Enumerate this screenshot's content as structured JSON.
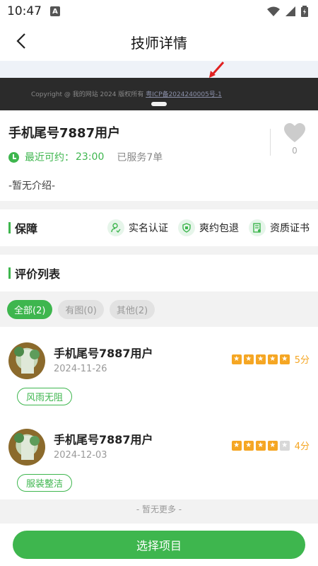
{
  "status": {
    "time": "10:47",
    "a_icon": "A"
  },
  "header": {
    "title": "技师详情"
  },
  "banner": {
    "copyright": "Copyright @ 我的网站 2024 版权所有",
    "icp": "粤ICP备2024240005号-1"
  },
  "profile": {
    "name": "手机尾号7887用户",
    "avail_label": "最近可约：",
    "avail_time": "23:00",
    "served": "已服务7单",
    "intro": "-暂无介绍-",
    "favorites": "0"
  },
  "guarantee": {
    "title": "保障",
    "items": [
      {
        "label": "实名认证",
        "icon": "person-check-icon"
      },
      {
        "label": "爽约包退",
        "icon": "shield-icon"
      },
      {
        "label": "资质证书",
        "icon": "certificate-icon"
      }
    ]
  },
  "reviews": {
    "title": "评价列表",
    "filters": [
      "全部(2)",
      "有图(0)",
      "其他(2)"
    ],
    "items": [
      {
        "name": "手机尾号7887用户",
        "date": "2024-11-26",
        "rating": 5,
        "score": "5分",
        "tag": "风雨无阻"
      },
      {
        "name": "手机尾号7887用户",
        "date": "2024-12-03",
        "rating": 4,
        "score": "4分",
        "tag": "服装整洁"
      }
    ],
    "no_more": "- 暂无更多 -"
  },
  "footer": {
    "button": "选择项目"
  },
  "colors": {
    "accent": "#3eb64e",
    "star": "#f5a623"
  }
}
